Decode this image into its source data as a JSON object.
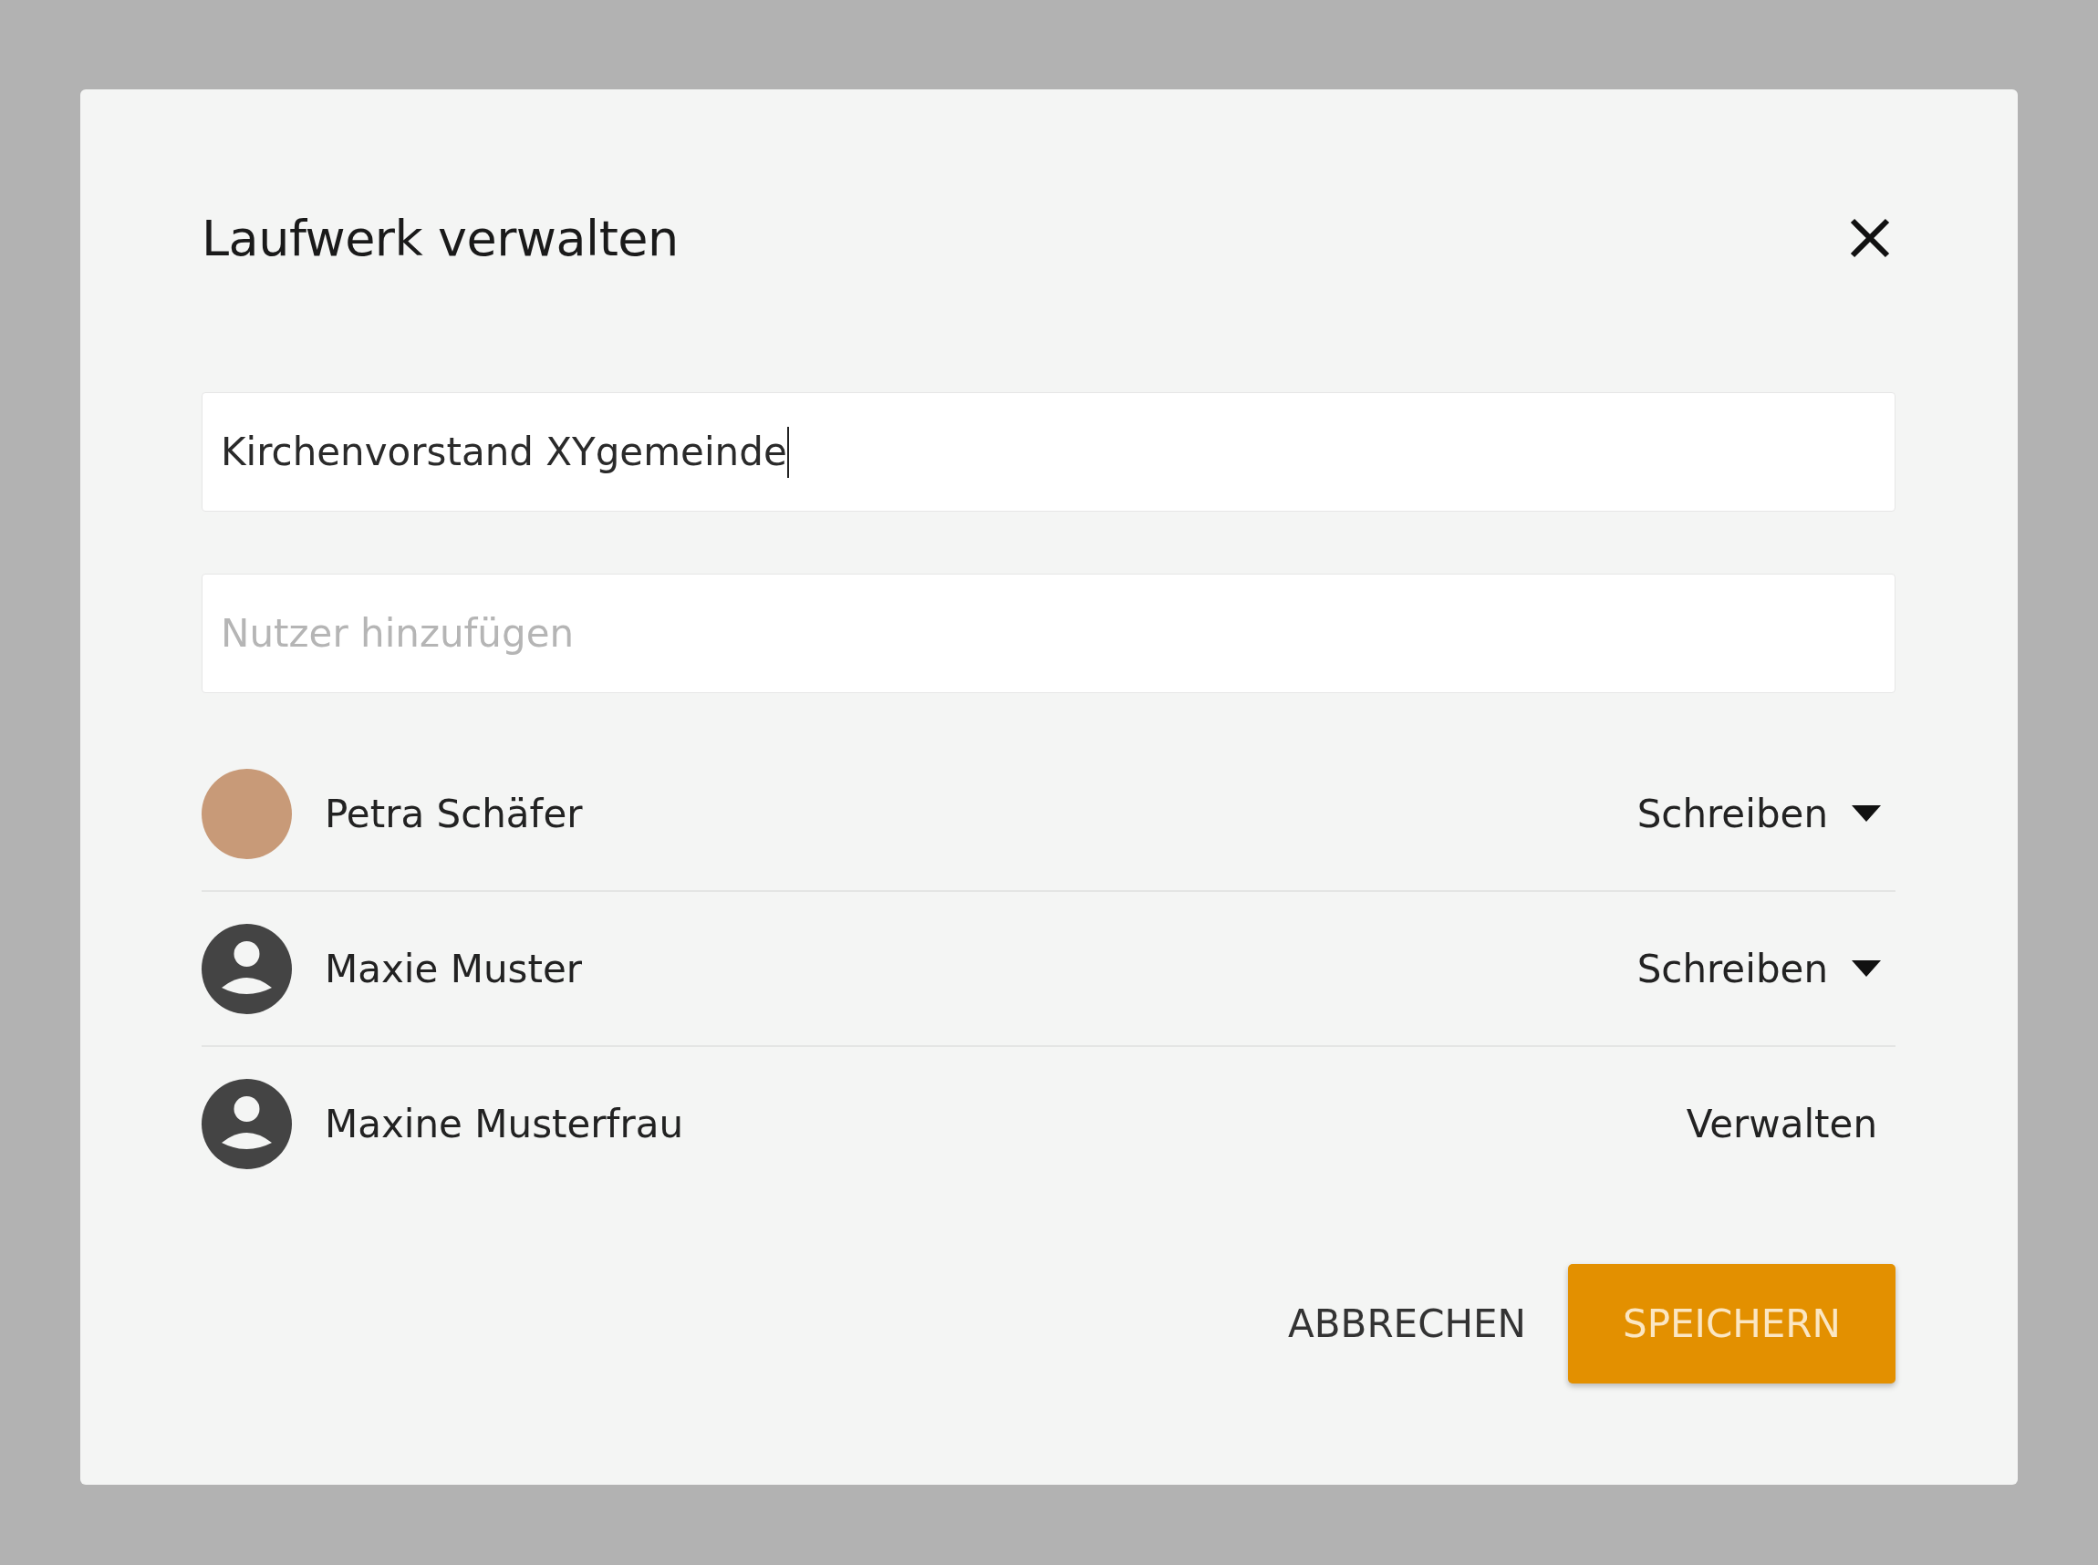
{
  "dialog": {
    "title": "Laufwerk verwalten"
  },
  "name_field": {
    "value": "Kirchenvorstand XYgemeinde",
    "focused": true
  },
  "user_field": {
    "placeholder": "Nutzer hinzufügen"
  },
  "members": [
    {
      "name": "Petra Schäfer",
      "has_photo": true,
      "permission": "Schreiben",
      "kind": "dropdown"
    },
    {
      "name": "Maxie Muster",
      "has_photo": false,
      "permission": "Schreiben",
      "kind": "dropdown"
    },
    {
      "name": "Maxine Musterfrau",
      "has_photo": false,
      "permission": "Verwalten",
      "kind": "static"
    }
  ],
  "buttons": {
    "cancel": "ABBRECHEN",
    "save": "SPEICHERN"
  }
}
